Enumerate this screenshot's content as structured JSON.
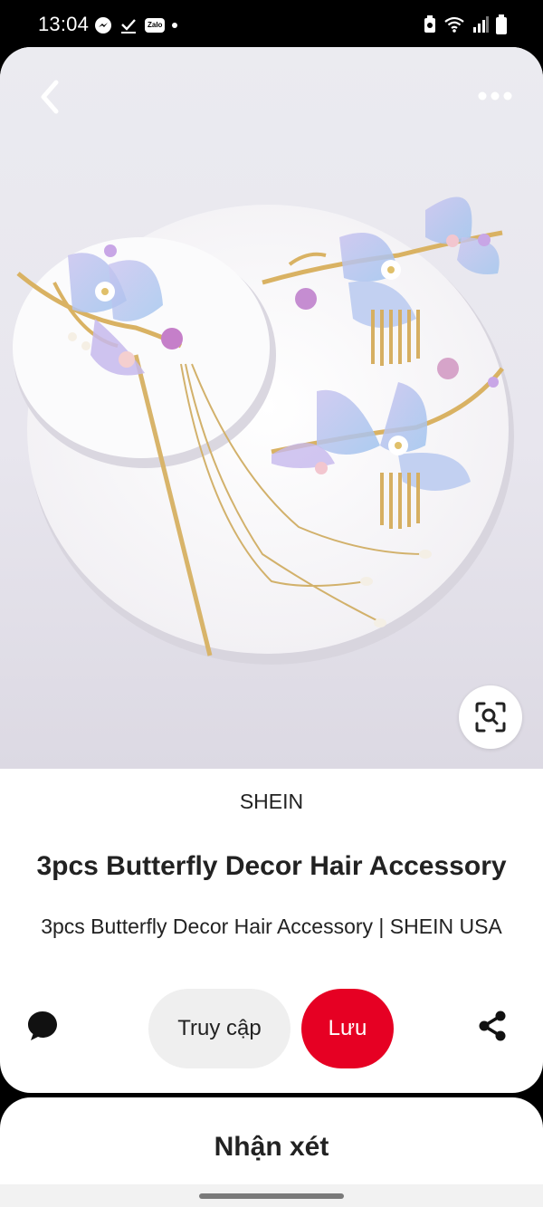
{
  "status_bar": {
    "time": "13:04",
    "left_icons": [
      "messenger-icon",
      "download-done-icon",
      "zalo-icon",
      "notification-dot"
    ],
    "zalo_label": "Zalo",
    "right_icons": [
      "battery-saver-icon",
      "wifi-icon",
      "signal-icon",
      "battery-icon"
    ]
  },
  "pin": {
    "brand": "SHEIN",
    "title": "3pcs Butterfly Decor Hair Accessory",
    "description": "3pcs Butterfly Decor Hair Accessory | SHEIN USA"
  },
  "actions": {
    "visit_label": "Truy cập",
    "save_label": "Lưu"
  },
  "comments": {
    "title": "Nhận xét"
  },
  "colors": {
    "save_button": "#e60023",
    "visit_button": "#efefef",
    "background": "#ffffff"
  }
}
